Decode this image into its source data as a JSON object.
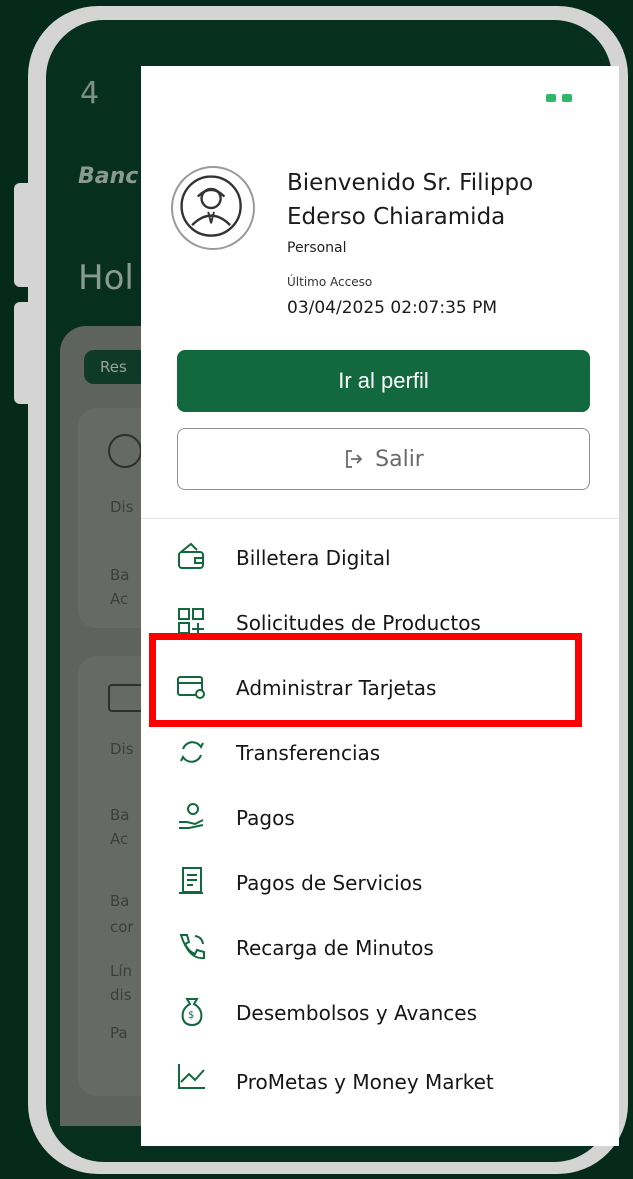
{
  "status_bar": {
    "time": "4"
  },
  "background_app": {
    "brand": "Banc",
    "greeting": "Hol",
    "tag": "Res",
    "card1": {
      "line1": "Dis",
      "line2": "Ba",
      "line3": "Ac"
    },
    "card2": {
      "line1": "Dis",
      "line2": "Ba",
      "line3": "Ac",
      "line4": "Ba",
      "line5": "cor",
      "line6": "Lín",
      "line7": "dis",
      "line8": "Pa"
    }
  },
  "profile": {
    "welcome": "Bienvenido Sr. Filippo Ederso Chiaramida",
    "role": "Personal",
    "last_access_label": "Último Acceso",
    "last_access_value": "03/04/2025 02:07:35 PM"
  },
  "buttons": {
    "profile_label": "Ir al perfil",
    "logout_label": "Salir",
    "logout_icon": "logout-arrow-icon"
  },
  "menu": [
    {
      "label": "Billetera Digital",
      "icon": "wallet-icon"
    },
    {
      "label": "Solicitudes de Productos",
      "icon": "grid-plus-icon"
    },
    {
      "label": "Administrar Tarjetas",
      "icon": "card-settings-icon"
    },
    {
      "label": "Transferencias",
      "icon": "transfer-icon"
    },
    {
      "label": "Pagos",
      "icon": "hand-money-icon"
    },
    {
      "label": "Pagos de Servicios",
      "icon": "receipt-icon"
    },
    {
      "label": "Recarga de Minutos",
      "icon": "phone-call-icon"
    },
    {
      "label": "Desembolsos y Avances",
      "icon": "money-bag-icon"
    },
    {
      "label": "ProMetas y Money Market",
      "icon": "trend-chart-icon"
    }
  ],
  "colors": {
    "primary_green": "#13693e",
    "background_dark": "#052a1c",
    "highlight_red": "#ff0000"
  }
}
